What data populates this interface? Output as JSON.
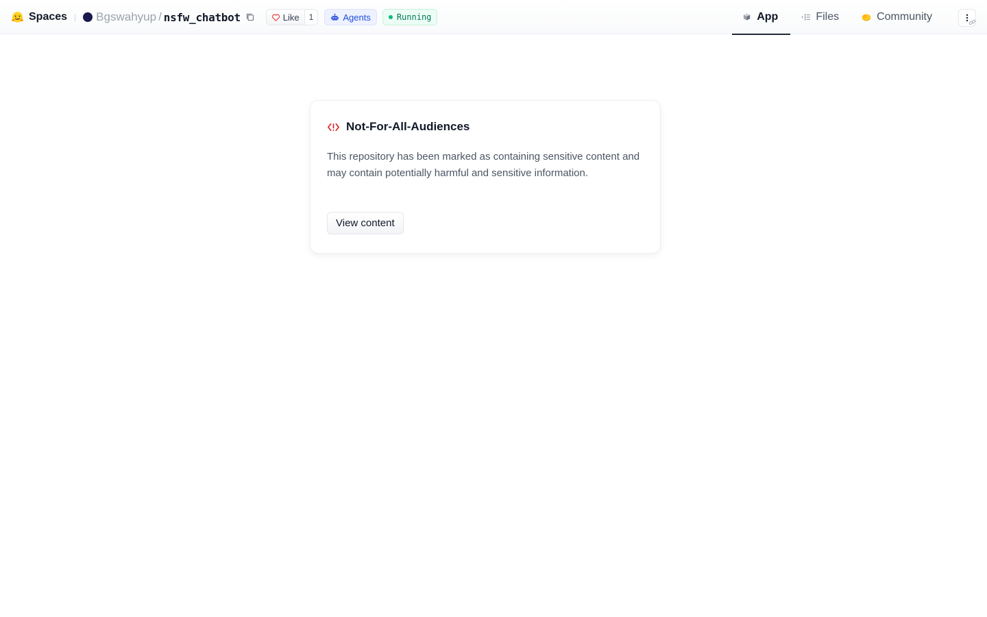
{
  "header": {
    "spaces_label": "Spaces",
    "owner": "Bgswahyup",
    "separator": "/",
    "repo": "nsfw_chatbot",
    "like_label": "Like",
    "like_count": "1",
    "agents_label": "Agents",
    "status_label": "Running"
  },
  "tabs": [
    {
      "label": "App",
      "icon": "cube-icon",
      "active": true
    },
    {
      "label": "Files",
      "icon": "files-icon",
      "active": false
    },
    {
      "label": "Community",
      "icon": "community-icon",
      "active": false
    }
  ],
  "notice": {
    "title": "Not-For-All-Audiences",
    "body": "This repository has been marked as containing sensitive content and may contain potentially harmful and sensitive information.",
    "button_label": "View content"
  },
  "colors": {
    "accent_agents": "#1d4ed8",
    "status_running": "#10b981",
    "warning": "#dc2626",
    "owner_avatar": "#1a1a4e"
  }
}
